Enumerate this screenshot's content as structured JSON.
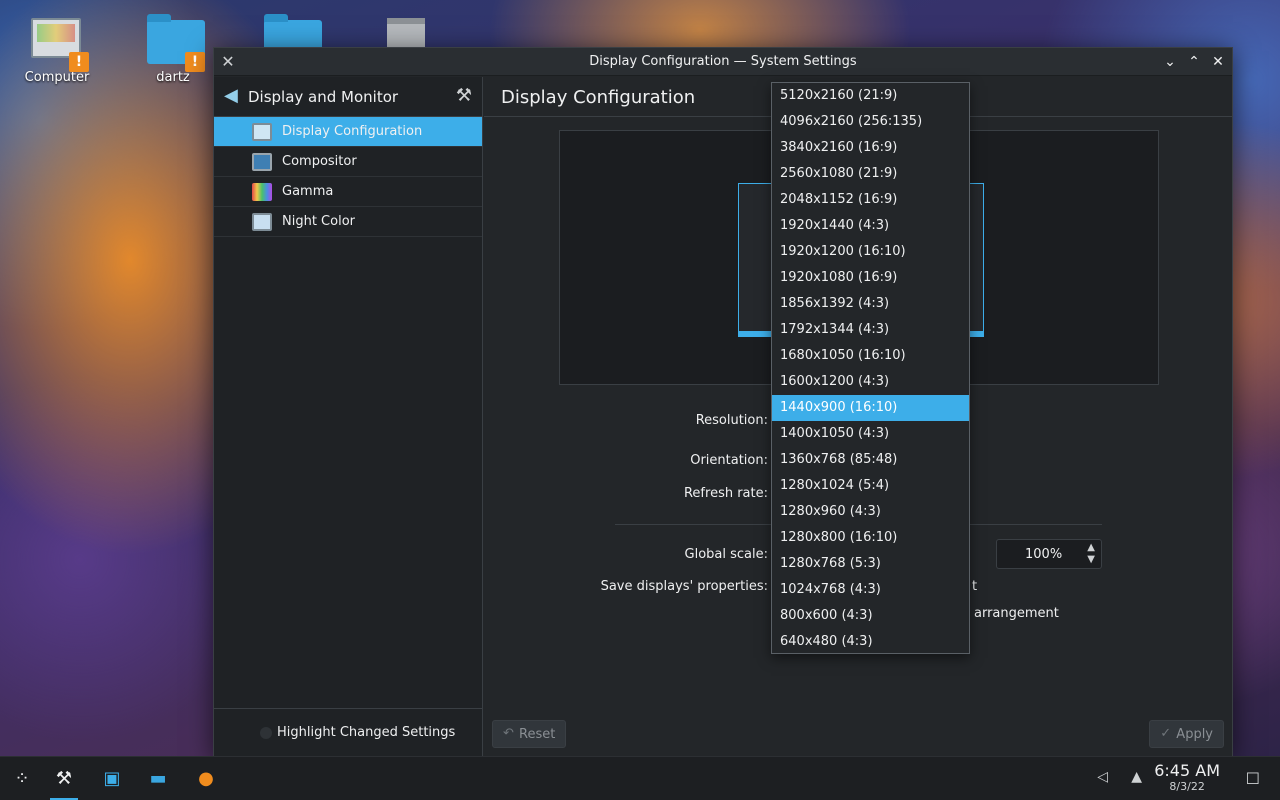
{
  "desktop": {
    "icons": [
      {
        "label": "Computer",
        "icon": "computer-icon"
      },
      {
        "label": "dartz",
        "icon": "home-folder-icon"
      },
      {
        "label": "",
        "icon": "folder-icon"
      },
      {
        "label": "",
        "icon": "trash-icon"
      }
    ]
  },
  "window": {
    "title": "Display Configuration — System Settings",
    "controls": [
      "minimize",
      "maximize",
      "close"
    ]
  },
  "sidebar": {
    "header": "Display and Monitor",
    "items": [
      {
        "label": "Display Configuration",
        "icon": "monitor-icon",
        "active": true
      },
      {
        "label": "Compositor",
        "icon": "compositor-icon",
        "active": false
      },
      {
        "label": "Gamma",
        "icon": "gamma-icon",
        "active": false
      },
      {
        "label": "Night Color",
        "icon": "night-color-icon",
        "active": false
      }
    ],
    "footer": "Highlight Changed Settings"
  },
  "content": {
    "title": "Display Configuration",
    "labels": {
      "resolution": "Resolution:",
      "orientation": "Orientation:",
      "refresh_rate": "Refresh rate:",
      "global_scale": "Global scale:",
      "save_props": "Save displays' properties:"
    },
    "global_scale_value": "100%",
    "save_option_tail_1": "t",
    "save_option_tail_2": "arrangement",
    "reset_label": "Reset",
    "apply_label": "Apply"
  },
  "resolution_dropdown": {
    "options": [
      "5120x2160 (21:9)",
      "4096x2160 (256:135)",
      "3840x2160 (16:9)",
      "2560x1080 (21:9)",
      "2048x1152 (16:9)",
      "1920x1440 (4:3)",
      "1920x1200 (16:10)",
      "1920x1080 (16:9)",
      "1856x1392 (4:3)",
      "1792x1344 (4:3)",
      "1680x1050 (16:10)",
      "1600x1200 (4:3)",
      "1440x900 (16:10)",
      "1400x1050 (4:3)",
      "1360x768 (85:48)",
      "1280x1024 (5:4)",
      "1280x960 (4:3)",
      "1280x800 (16:10)",
      "1280x768 (5:3)",
      "1024x768 (4:3)",
      "800x600 (4:3)",
      "640x480 (4:3)"
    ],
    "selected": "1440x900 (16:10)"
  },
  "taskbar": {
    "time": "6:45 AM",
    "date": "8/3/22",
    "apps": [
      "launcher-icon",
      "system-settings-icon",
      "discover-icon",
      "dolphin-icon",
      "firefox-icon"
    ]
  },
  "colors": {
    "accent": "#3daee9",
    "window_bg": "#232629"
  }
}
